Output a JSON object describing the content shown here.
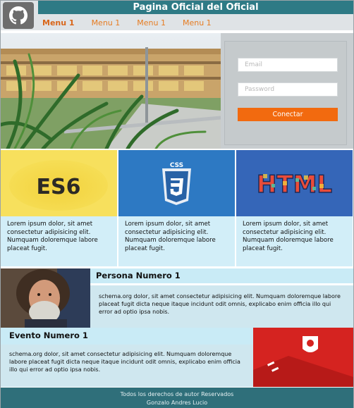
{
  "header": {
    "title": "Pagina Oficial del Oficial",
    "logo_icon": "github-icon",
    "menu": [
      {
        "label": "Menu 1"
      },
      {
        "label": "Menu 1"
      },
      {
        "label": "Menu 1"
      },
      {
        "label": "Menu 1"
      }
    ]
  },
  "login": {
    "email_placeholder": "Email",
    "password_placeholder": "Password",
    "connect_label": "Conectar"
  },
  "cards": [
    {
      "image": "es6-logo",
      "image_text": "ES6",
      "text": "Lorem ipsum dolor, sit amet consectetur adipisicing elit. Numquam doloremque labore placeat fugit."
    },
    {
      "image": "css3-logo",
      "image_text": "CSS",
      "text": "Lorem ipsum dolor, sit amet consectetur adipisicing elit. Numquam doloremque labore placeat fugit."
    },
    {
      "image": "html-logo",
      "image_text": "HTML",
      "text": "Lorem ipsum dolor, sit amet consectetur adipisicing elit. Numquam doloremque labore placeat fugit."
    }
  ],
  "person": {
    "title": "Persona Numero 1",
    "text": "schema.org dolor, sit amet consectetur adipisicing elit. Numquam doloremque labore placeat fugit dicta neque itaque incidunt odit omnis, explicabo enim officia illo qui error ad optio ipsa nobis."
  },
  "event": {
    "title": "Evento Numero 1",
    "text": "schema.org dolor, sit amet consectetur adipisicing elit. Numquam doloremque labore placeat fugit dicta neque itaque incidunt odit omnis, explicabo enim officia illo qui error ad optio ipsa nobis."
  },
  "footer": {
    "line1": "Todos los derechos de autor Reservados",
    "line2": "Gonzalo Andres Lucio"
  },
  "colors": {
    "accent_orange": "#f26a0f",
    "header_teal": "#2e7a85",
    "card_text_bg": "#d2eef8"
  }
}
